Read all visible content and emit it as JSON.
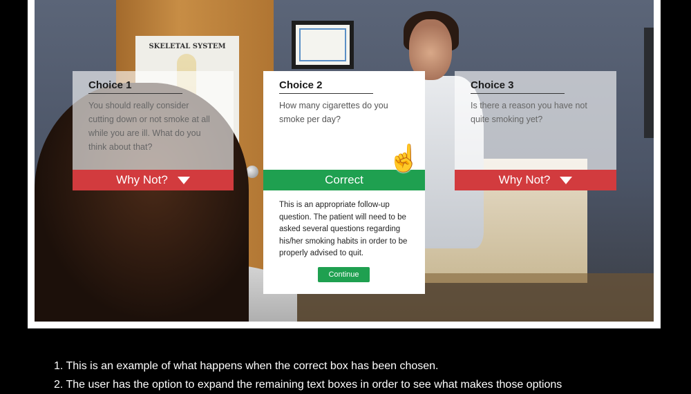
{
  "scene": {
    "poster_title": "SKELETAL SYSTEM"
  },
  "choices": [
    {
      "title": "Choice 1",
      "text": "You should really consider cutting down or not smoke at all while you are ill.  What do you think about that?",
      "button_label": "Why Not?",
      "state": "incorrect"
    },
    {
      "title": "Choice 2",
      "text": "How many cigarettes do you smoke per day?",
      "button_label": "Correct",
      "state": "correct",
      "feedback": "This is an appropriate follow-up question.  The patient will need to be asked several questions regarding his/her smoking habits in order to be properly advised to quit.",
      "continue_label": "Continue"
    },
    {
      "title": "Choice 3",
      "text": "Is there a reason you have not quite smoking yet?",
      "button_label": "Why Not?",
      "state": "incorrect"
    }
  ],
  "notes": [
    "1. This is an example of what happens when the correct box has been chosen.",
    "2. The user has the option to expand the remaining text boxes in order to see what makes those options"
  ],
  "colors": {
    "correct_green": "#1fa050",
    "incorrect_red": "#d23b3e"
  },
  "icons": {
    "cursor": "hand-pointer-icon",
    "expand": "triangle-down-icon"
  }
}
